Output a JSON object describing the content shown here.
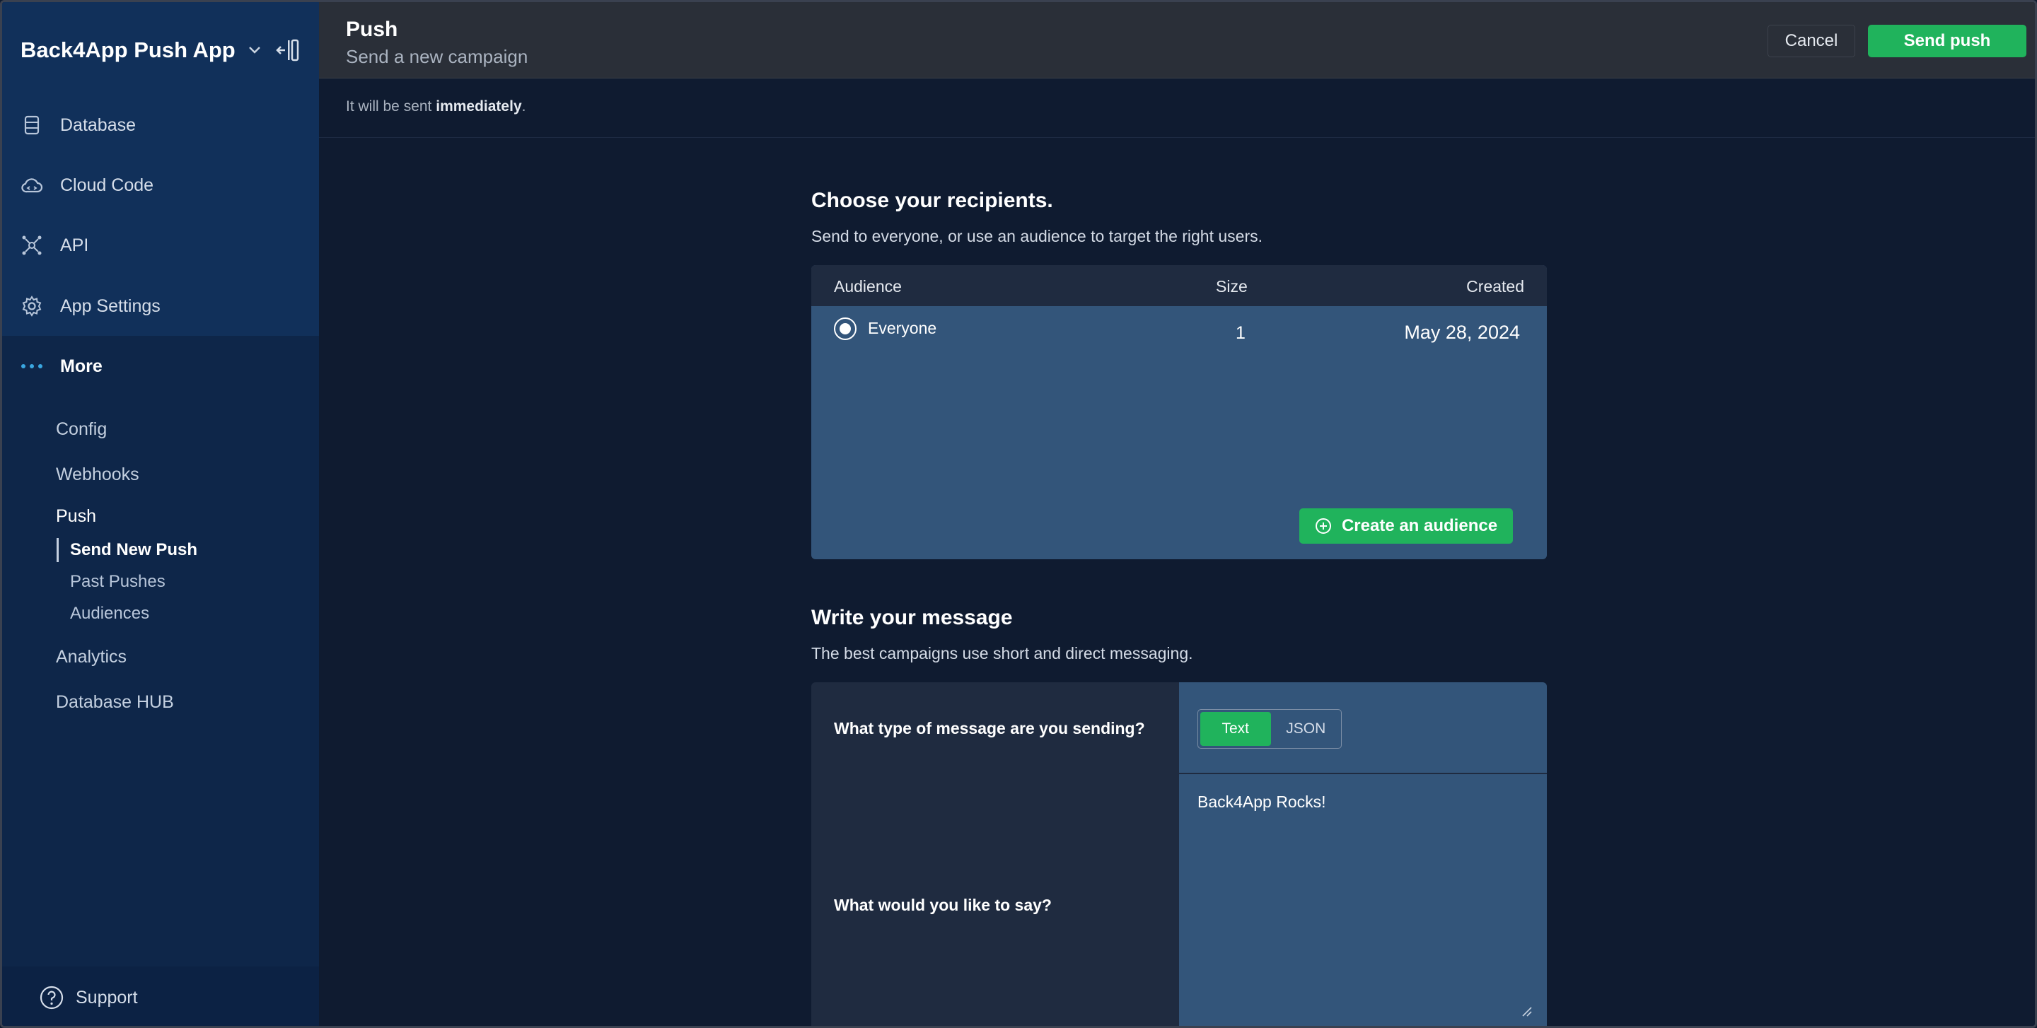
{
  "sidebar": {
    "app_name": "Back4App Push App",
    "items": [
      {
        "label": "Database",
        "icon": "database-icon"
      },
      {
        "label": "Cloud Code",
        "icon": "cloud-code-icon"
      },
      {
        "label": "API",
        "icon": "api-icon"
      },
      {
        "label": "App Settings",
        "icon": "gear-icon"
      },
      {
        "label": "More",
        "icon": "more-dots-icon"
      }
    ],
    "more_items": [
      "Config",
      "Webhooks",
      "Push",
      "Analytics",
      "Database HUB"
    ],
    "push_items": [
      "Send New Push",
      "Past Pushes",
      "Audiences"
    ],
    "support_label": "Support"
  },
  "header": {
    "title": "Push",
    "subtitle": "Send a new campaign",
    "cancel_label": "Cancel",
    "send_label": "Send push"
  },
  "notice": {
    "prefix": "It will be sent ",
    "emphasis": "immediately",
    "suffix": "."
  },
  "recipients": {
    "title": "Choose your recipients.",
    "description": "Send to everyone, or use an audience to target the right users.",
    "columns": [
      "Audience",
      "Size",
      "Created"
    ],
    "rows": [
      {
        "name": "Everyone",
        "size": "1",
        "created": "May 28, 2024",
        "selected": true
      }
    ],
    "create_label": "Create an audience"
  },
  "message": {
    "title": "Write your message",
    "description": "The best campaigns use short and direct messaging.",
    "type_question": "What type of message are you sending?",
    "type_options": [
      "Text",
      "JSON"
    ],
    "type_selected": "Text",
    "say_question": "What would you like to say?",
    "text_value": "Back4App Rocks!"
  },
  "colors": {
    "accent": "#20b35c",
    "sidebar": "#0e2649",
    "panel": "#33557a",
    "background": "#0f1b30"
  }
}
